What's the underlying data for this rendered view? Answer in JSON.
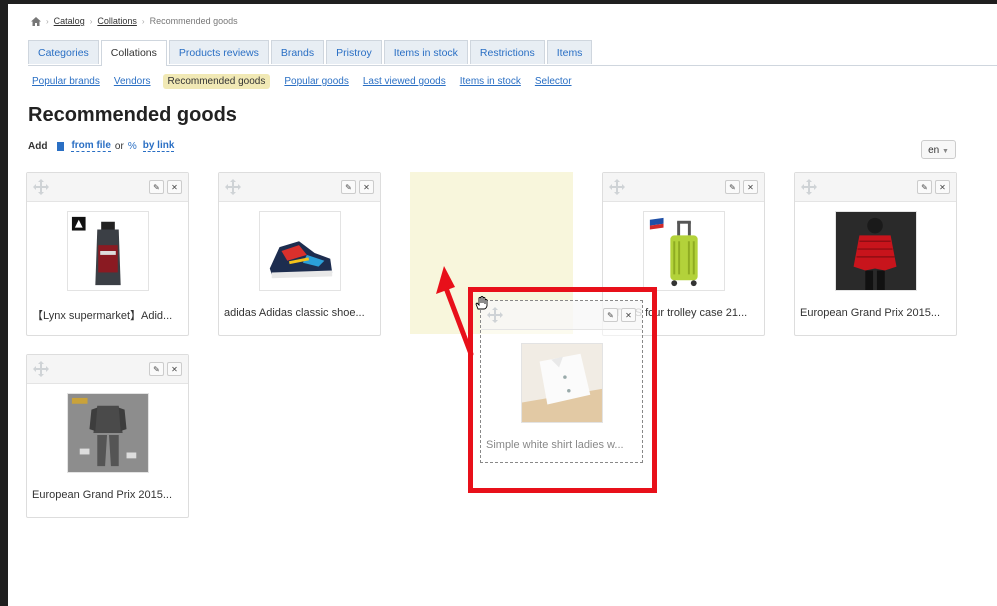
{
  "breadcrumb": {
    "home": "home-icon",
    "items": [
      "Catalog",
      "Collations",
      "Recommended goods"
    ]
  },
  "tabs": [
    "Categories",
    "Collations",
    "Products reviews",
    "Brands",
    "Pristroy",
    "Items in stock",
    "Restrictions",
    "Items"
  ],
  "active_tab": "Collations",
  "subnav": [
    "Popular brands",
    "Vendors",
    "Recommended goods",
    "Popular goods",
    "Last viewed goods",
    "Items in stock",
    "Selector"
  ],
  "active_subnav": "Recommended goods",
  "page_title": "Recommended goods",
  "add": {
    "label": "Add",
    "from_file": "from file",
    "or": "or",
    "by_link": "by link"
  },
  "language": "en",
  "products": [
    {
      "name": "【Lynx supermarket】Adid...",
      "image": "shower-gel-bottle"
    },
    {
      "name": "adidas Adidas classic shoe...",
      "image": "sneaker"
    },
    {
      "name": "ATLAS four trolley case 21...",
      "image": "trolley-case"
    },
    {
      "name": "European Grand Prix 2015...",
      "image": "red-jacket"
    },
    {
      "name": "European Grand Prix 2015...",
      "image": "grey-outfit"
    }
  ],
  "dragging_product": {
    "name": "Simple white shirt ladies w...",
    "image": "white-shirt"
  },
  "colors": {
    "link": "#2a6fc4",
    "active_subnav_bg": "#f1e9b5",
    "placeholder_bg": "#f8f6dc",
    "annotation": "#e8101a"
  }
}
